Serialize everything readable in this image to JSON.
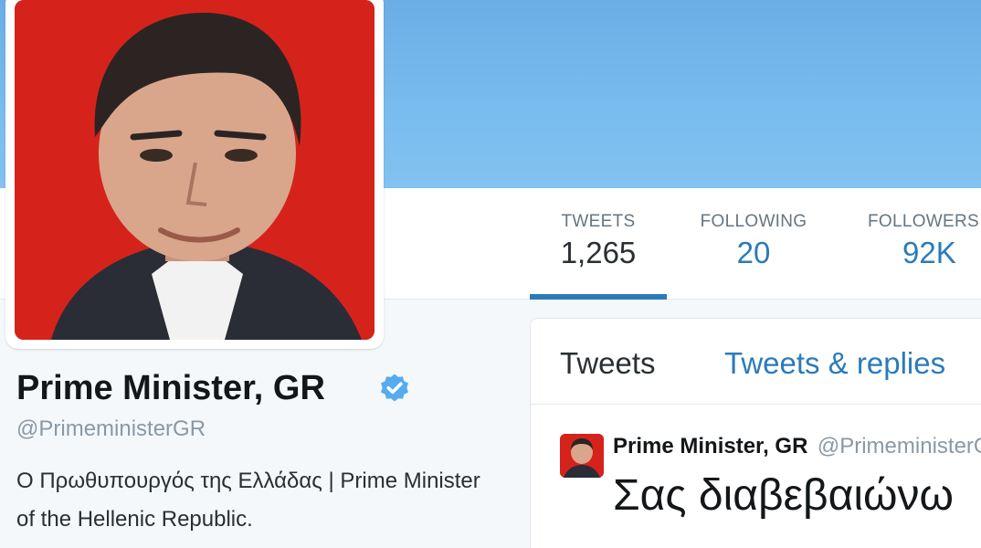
{
  "profile": {
    "name": "Prime Minister, GR",
    "handle": "@PrimeministerGR",
    "bio": "Ο Πρωθυπουργός της Ελλάδας | Prime Minister of the Hellenic Republic."
  },
  "stats": [
    {
      "label": "TWEETS",
      "value": "1,265"
    },
    {
      "label": "FOLLOWING",
      "value": "20"
    },
    {
      "label": "FOLLOWERS",
      "value": "92K"
    }
  ],
  "tabs": {
    "tweets": "Tweets",
    "replies": "Tweets & replies"
  },
  "tweet": {
    "author_name": "Prime Minister, GR",
    "author_handle": "@PrimeministerGR",
    "text": "Σας διαβεβαιώνω"
  },
  "colors": {
    "accent": "#2b7bb9",
    "banner": "#79bcee",
    "avatar_background": "#d5231c",
    "verified": "#55acee"
  },
  "icons": {
    "verified": "verified-badge-icon"
  }
}
